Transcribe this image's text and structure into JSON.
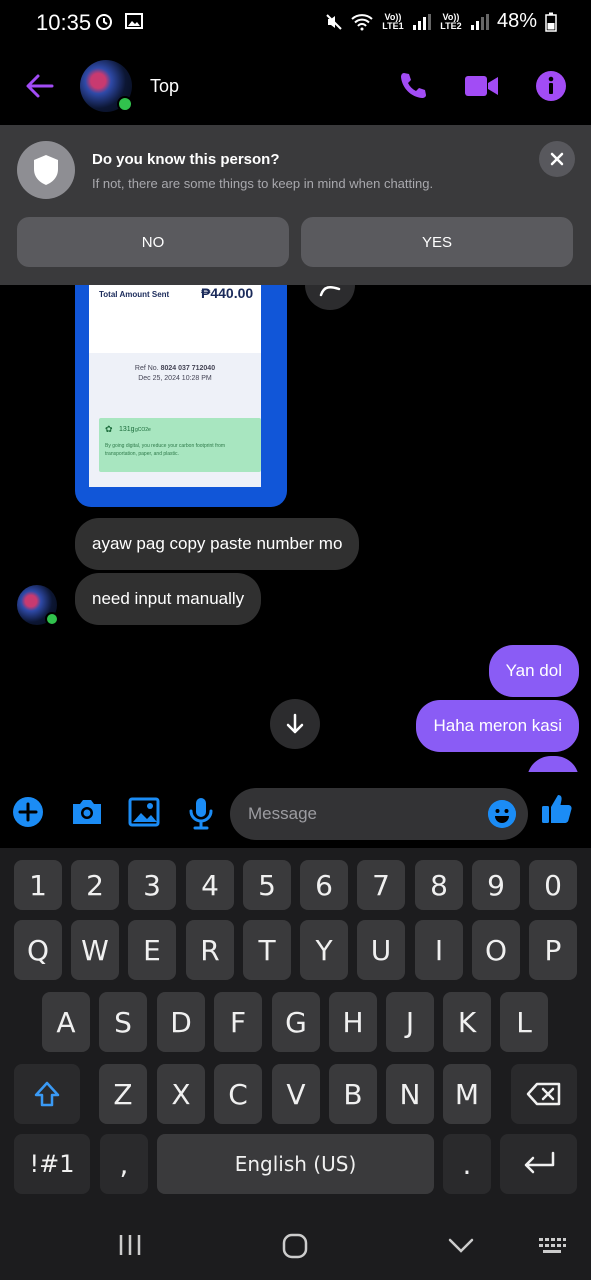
{
  "status_bar": {
    "time": "10:35",
    "battery": "48%",
    "sim1": "Vo)) LTE1",
    "sim2": "Vo)) LTE2"
  },
  "header": {
    "contact_name": "Top"
  },
  "banner": {
    "title": "Do you know this person?",
    "subtitle": "If not, there are some things to keep in mind when chatting.",
    "no_label": "NO",
    "yes_label": "YES"
  },
  "receipt": {
    "total_label": "Total Amount Sent",
    "total_value": "₱440.00",
    "ref_label": "Ref No.",
    "ref_number": "8024 037 712040",
    "date": "Dec 25, 2024 10:28 PM",
    "carbon_amount": "131g",
    "carbon_unit": "gCO2e",
    "carbon_text": "By going digital, you reduce your carbon footprint from transportation, paper, and plastic."
  },
  "messages": [
    {
      "direction": "in",
      "text": "ayaw pag copy paste number mo"
    },
    {
      "direction": "in",
      "text": "need input manually"
    },
    {
      "direction": "out",
      "text": "Yan dol"
    },
    {
      "direction": "out",
      "text": "Haha meron kasi"
    }
  ],
  "composer": {
    "placeholder": "Message"
  },
  "keyboard": {
    "number_row": [
      "1",
      "2",
      "3",
      "4",
      "5",
      "6",
      "7",
      "8",
      "9",
      "0"
    ],
    "row1": [
      "Q",
      "W",
      "E",
      "R",
      "T",
      "Y",
      "U",
      "I",
      "O",
      "P"
    ],
    "row2": [
      "A",
      "S",
      "D",
      "F",
      "G",
      "H",
      "J",
      "K",
      "L"
    ],
    "row3": [
      "Z",
      "X",
      "C",
      "V",
      "B",
      "N",
      "M"
    ],
    "symbols_label": "!#1",
    "comma_label": ",",
    "space_label": "English (US)",
    "period_label": "."
  },
  "colors": {
    "accent": "#a24cf5",
    "outgoing_bubble": "#8a5cf5",
    "messenger_blue": "#1b8cf5",
    "online_dot": "#31c24d"
  },
  "icons": {
    "header": [
      "back-arrow-icon",
      "phone-icon",
      "video-icon",
      "info-icon"
    ],
    "composer": [
      "plus-icon",
      "camera-icon",
      "gallery-icon",
      "mic-icon",
      "emoji-icon",
      "thumbs-up-icon"
    ]
  }
}
